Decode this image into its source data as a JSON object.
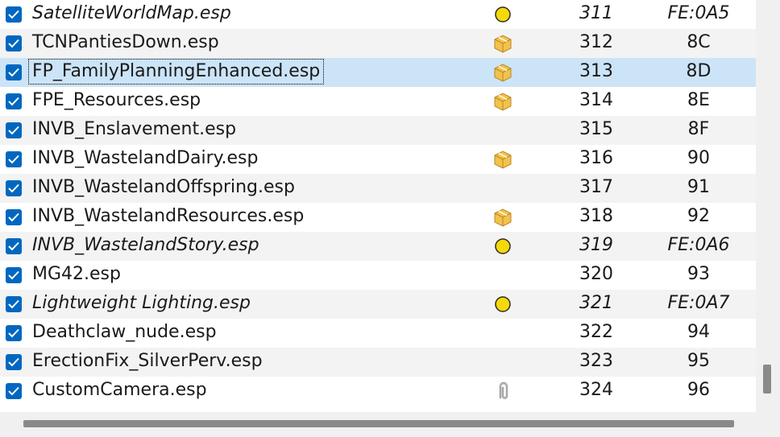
{
  "rows": [
    {
      "name": "SatelliteWorldMap.esp",
      "index": "311",
      "mod_id": "FE:0A5",
      "flag_icon": "light-plugin-dot-icon",
      "italic": true
    },
    {
      "name": "TCNPantiesDown.esp",
      "index": "312",
      "mod_id": "8C",
      "flag_icon": "package-icon",
      "italic": false
    },
    {
      "name": "FP_FamilyPlanningEnhanced.esp",
      "index": "313",
      "mod_id": "8D",
      "flag_icon": "package-icon",
      "italic": false,
      "selected": true
    },
    {
      "name": "FPE_Resources.esp",
      "index": "314",
      "mod_id": "8E",
      "flag_icon": "package-icon",
      "italic": false
    },
    {
      "name": "INVB_Enslavement.esp",
      "index": "315",
      "mod_id": "8F",
      "flag_icon": "",
      "italic": false
    },
    {
      "name": "INVB_WastelandDairy.esp",
      "index": "316",
      "mod_id": "90",
      "flag_icon": "package-icon",
      "italic": false
    },
    {
      "name": "INVB_WastelandOffspring.esp",
      "index": "317",
      "mod_id": "91",
      "flag_icon": "",
      "italic": false
    },
    {
      "name": "INVB_WastelandResources.esp",
      "index": "318",
      "mod_id": "92",
      "flag_icon": "package-icon",
      "italic": false
    },
    {
      "name": "INVB_WastelandStory.esp",
      "index": "319",
      "mod_id": "FE:0A6",
      "flag_icon": "light-plugin-dot-icon",
      "italic": true
    },
    {
      "name": "MG42.esp",
      "index": "320",
      "mod_id": "93",
      "flag_icon": "",
      "italic": false
    },
    {
      "name": "Lightweight Lighting.esp",
      "index": "321",
      "mod_id": "FE:0A7",
      "flag_icon": "light-plugin-dot-icon",
      "italic": true
    },
    {
      "name": "Deathclaw_nude.esp",
      "index": "322",
      "mod_id": "94",
      "flag_icon": "",
      "italic": false
    },
    {
      "name": "ErectionFix_SilverPerv.esp",
      "index": "323",
      "mod_id": "95",
      "flag_icon": "",
      "italic": false
    },
    {
      "name": "CustomCamera.esp",
      "index": "324",
      "mod_id": "96",
      "flag_icon": "paperclip-icon",
      "italic": false
    }
  ],
  "colors": {
    "checkbox": "#0067c0",
    "selection": "#cce4f7",
    "light_dot": "#f5d90a",
    "package": "#f2c24b"
  }
}
